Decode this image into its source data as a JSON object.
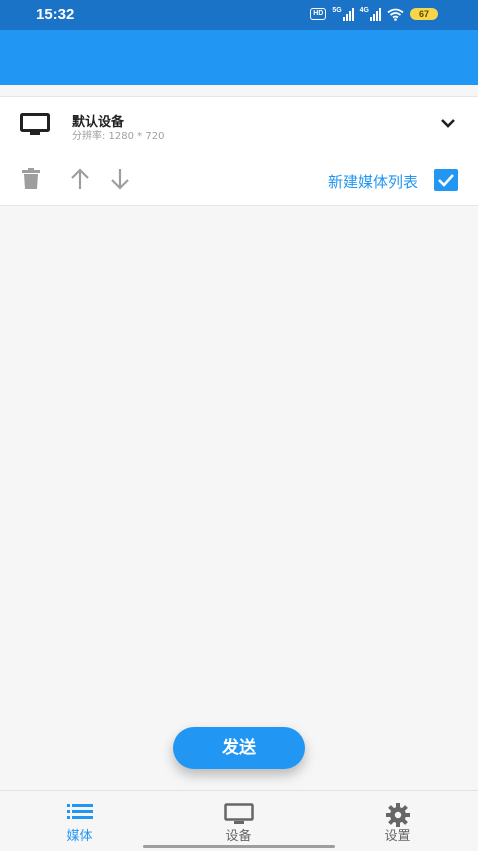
{
  "status_bar": {
    "time": "15:32",
    "hd": "HD",
    "net1": "5G",
    "net2": "4G",
    "battery": "67"
  },
  "device": {
    "name": "默认设备",
    "resolution": "分辨率: 1280 * 720"
  },
  "toolbar": {
    "new_list_label": "新建媒体列表",
    "checkbox_checked": true
  },
  "send_button": "发送",
  "bottom_nav": {
    "media": "媒体",
    "device": "设备",
    "settings": "设置"
  },
  "colors": {
    "primary": "#2196f3",
    "status_bar": "#1a73c7",
    "background": "#f6f6f6"
  }
}
